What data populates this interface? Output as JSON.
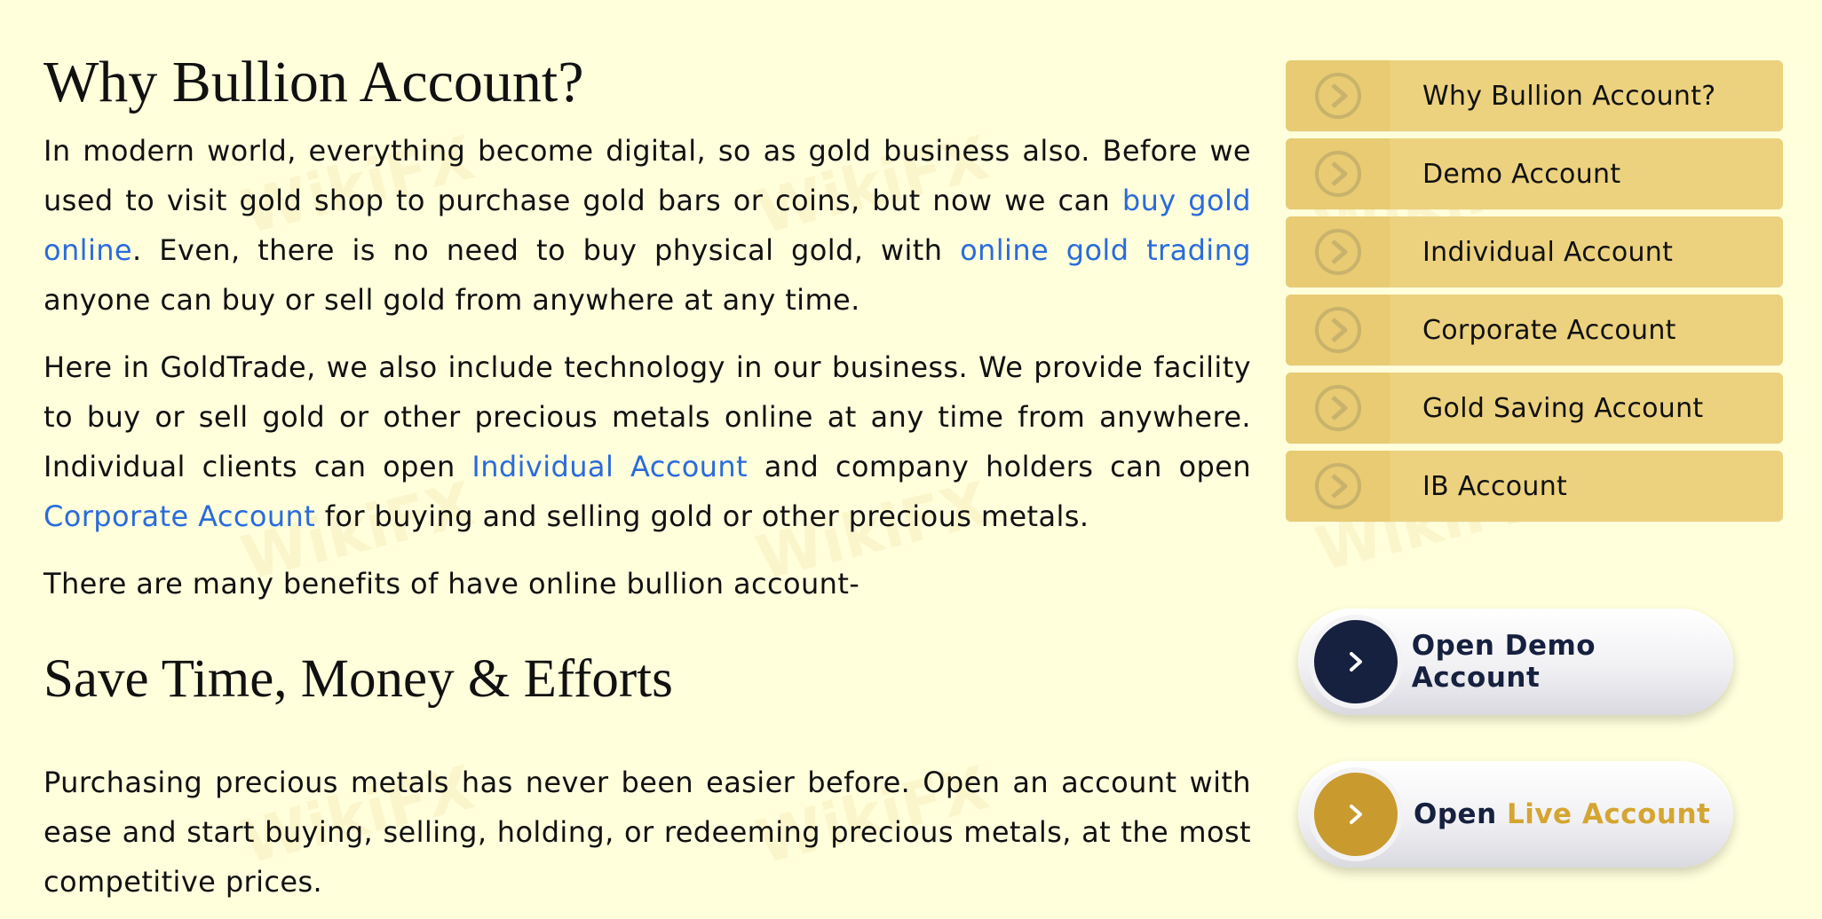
{
  "main": {
    "heading1": "Why Bullion Account?",
    "para1": {
      "t1": "In modern world, everything become digital, so as gold business also. Before we used to visit gold shop to purchase gold bars or coins, but now we can ",
      "link1": "buy gold online",
      "t2": ". Even, there is no need to buy physical gold, with ",
      "link2": "online gold trading",
      "t3": " anyone can buy or sell gold from anywhere at any time."
    },
    "para2": {
      "t1": "Here in GoldTrade, we also include technology in our business. We provide facility to buy or sell gold or other precious metals online at any time from anywhere. Individual clients can open ",
      "link1": "Individual Account",
      "t2": " and company holders can open ",
      "link2": "Corporate Account",
      "t3": " for buying and selling gold or other precious metals."
    },
    "para3": "There are many benefits of have online bullion account-",
    "heading2": "Save Time, Money & Efforts",
    "para4": "Purchasing precious metals has never been easier before. Open an account with ease and start buying, selling, holding, or redeeming precious metals, at the most competitive prices."
  },
  "sidebar": {
    "items": [
      {
        "label": "Why Bullion Account?",
        "icon": "chevron-circle-right-icon"
      },
      {
        "label": "Demo Account",
        "icon": "chevron-circle-right-icon"
      },
      {
        "label": "Individual Account",
        "icon": "chevron-circle-right-icon"
      },
      {
        "label": "Corporate Account",
        "icon": "chevron-circle-right-icon"
      },
      {
        "label": "Gold Saving Account",
        "icon": "chevron-circle-right-icon"
      },
      {
        "label": "IB Account",
        "icon": "chevron-circle-right-icon"
      }
    ]
  },
  "buttons": {
    "demo": {
      "label": "Open Demo Account",
      "icon": "chevron-right-icon",
      "circle_color": "#16203f"
    },
    "live": {
      "label_prefix": "Open ",
      "label_highlight": "Live Account",
      "icon": "chevron-right-icon",
      "circle_color": "#c99a2e"
    }
  },
  "colors": {
    "background": "#ffffdc",
    "link": "#2a6bdc",
    "sidebar_item": "#ecd27e",
    "navy": "#16203f",
    "gold": "#d4a531"
  },
  "watermark": "WikiFX"
}
